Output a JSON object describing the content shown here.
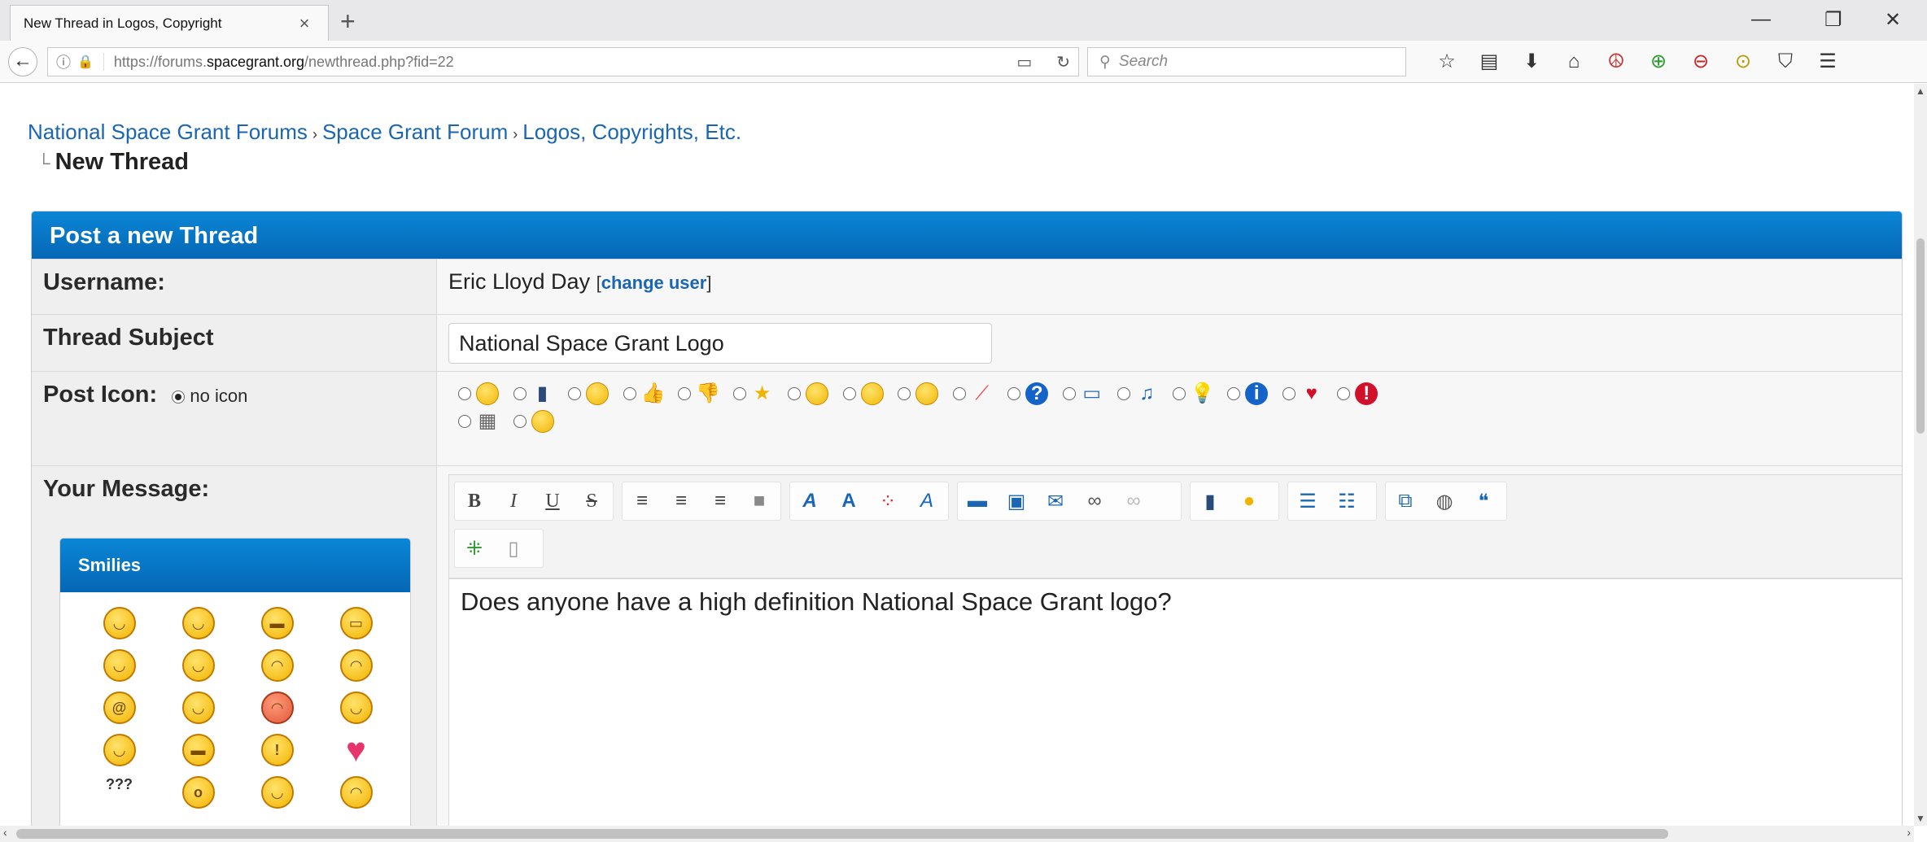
{
  "browser": {
    "tab_title": "New Thread in Logos, Copyright",
    "tab_close": "×",
    "new_tab": "+",
    "url_prefix": "https://forums.",
    "url_host": "spacegrant.org",
    "url_path": "/newthread.php?fid=22",
    "search_placeholder": "Search",
    "window_controls": [
      "—",
      "❐",
      "✕"
    ]
  },
  "breadcrumb": {
    "items": [
      "National Space Grant Forums",
      "Space Grant Forum",
      "Logos, Copyrights, Etc."
    ],
    "separator": "›",
    "current": "New Thread"
  },
  "form": {
    "header": "Post a new Thread",
    "username_label": "Username:",
    "username_value": "Eric Lloyd Day",
    "change_user_open": "[",
    "change_user": "change user",
    "change_user_close": "]",
    "subject_label": "Thread Subject",
    "subject_value": "National Space Grant Logo",
    "post_icon_label": "Post Icon:",
    "no_icon_label": "no icon",
    "message_label": "Your Message:",
    "message_text": "Does anyone have a high definition National Space Grant logo?"
  },
  "post_icons": [
    "smile-icon",
    "film-icon",
    "tongue-icon",
    "thumbs-up-icon",
    "thumbs-down-icon",
    "star-icon",
    "biggrin-icon",
    "angry-icon",
    "wink-icon",
    "rainbow-icon",
    "question-icon",
    "screen-icon",
    "music-icon",
    "lightbulb-icon",
    "info-icon",
    "heart-icon",
    "exclamation-icon",
    "clapper-icon",
    "grin-icon"
  ],
  "editor_toolbar": {
    "bold": "B",
    "italic": "I",
    "underline": "U",
    "strike": "S"
  },
  "smilies": {
    "title": "Smilies",
    "question_marks": "???"
  },
  "colors": {
    "header_blue": "#0567b5",
    "link_blue": "#1a66b4"
  }
}
